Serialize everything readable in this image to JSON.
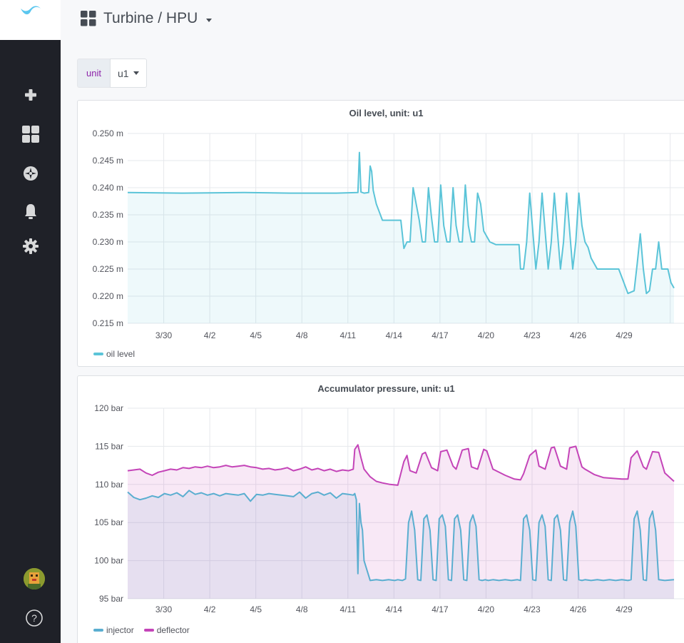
{
  "dashboard": {
    "title": "Turbine / HPU"
  },
  "variable": {
    "label": "unit",
    "value": "u1"
  },
  "colors": {
    "oil": "#5bc4d8",
    "injector": "#5aaed0",
    "deflector": "#c444b8"
  },
  "chart_data": [
    {
      "type": "area",
      "title": "Oil level, unit: u1",
      "y_unit": "m",
      "ylim": [
        0.215,
        0.25
      ],
      "y_ticks": [
        0.215,
        0.22,
        0.225,
        0.23,
        0.235,
        0.24,
        0.245,
        0.25
      ],
      "y_tick_labels": [
        "0.215 m",
        "0.220 m",
        "0.225 m",
        "0.230 m",
        "0.235 m",
        "0.240 m",
        "0.245 m",
        "0.250 m"
      ],
      "x_ticks": [
        3.75,
        6.75,
        9.75,
        12.75,
        15.75,
        18.75,
        21.75,
        24.75,
        27.75,
        30.75,
        33.75,
        36.75
      ],
      "x_tick_labels": [
        "3/30",
        "4/2",
        "4/5",
        "4/8",
        "4/11",
        "4/14",
        "4/17",
        "4/20",
        "4/23",
        "4/26",
        "4/29",
        ""
      ],
      "xlim": [
        1.4,
        37.0
      ],
      "grid": true,
      "legend_placement": "bottom-left",
      "series": [
        {
          "name": "oil level",
          "color": "#5bc4d8",
          "x": [
            1.4,
            5,
            9,
            12,
            15,
            16.4,
            16.5,
            16.6,
            16.7,
            16.8,
            17.1,
            17.2,
            17.3,
            17.4,
            17.6,
            17.8,
            18.0,
            18.3,
            18.8,
            19.2,
            19.4,
            19.6,
            19.8,
            20.0,
            20.2,
            20.4,
            20.6,
            20.8,
            21.0,
            21.2,
            21.4,
            21.6,
            21.8,
            22.0,
            22.2,
            22.4,
            22.6,
            22.8,
            23.0,
            23.2,
            23.4,
            23.6,
            23.8,
            24.0,
            24.2,
            24.4,
            24.6,
            24.8,
            25.0,
            25.4,
            26.0,
            26.6,
            26.9,
            27.0,
            27.2,
            27.4,
            27.6,
            27.8,
            28.0,
            28.2,
            28.4,
            28.6,
            28.8,
            29.0,
            29.2,
            29.4,
            29.6,
            29.8,
            30.0,
            30.2,
            30.4,
            30.6,
            30.8,
            31.0,
            31.2,
            31.4,
            31.6,
            31.8,
            32.0,
            32.2,
            32.6,
            33.0,
            33.4,
            34.0,
            34.4,
            34.6,
            34.8,
            35.0,
            35.2,
            35.4,
            35.6,
            35.8,
            36.0,
            36.2,
            36.4,
            36.6,
            36.8,
            37.0
          ],
          "y": [
            0.2391,
            0.239,
            0.2391,
            0.239,
            0.239,
            0.2391,
            0.2465,
            0.2392,
            0.2391,
            0.239,
            0.2391,
            0.244,
            0.243,
            0.2395,
            0.237,
            0.2355,
            0.234,
            0.234,
            0.234,
            0.234,
            0.2288,
            0.23,
            0.23,
            0.24,
            0.237,
            0.234,
            0.23,
            0.23,
            0.24,
            0.2345,
            0.23,
            0.23,
            0.2405,
            0.233,
            0.23,
            0.23,
            0.24,
            0.233,
            0.23,
            0.23,
            0.2405,
            0.233,
            0.23,
            0.23,
            0.239,
            0.237,
            0.232,
            0.231,
            0.23,
            0.2295,
            0.2295,
            0.2295,
            0.2295,
            0.225,
            0.225,
            0.23,
            0.239,
            0.232,
            0.225,
            0.23,
            0.239,
            0.232,
            0.225,
            0.23,
            0.239,
            0.232,
            0.225,
            0.23,
            0.239,
            0.232,
            0.225,
            0.23,
            0.239,
            0.233,
            0.23,
            0.229,
            0.227,
            0.226,
            0.225,
            0.225,
            0.225,
            0.225,
            0.225,
            0.2205,
            0.221,
            0.226,
            0.2315,
            0.225,
            0.2205,
            0.221,
            0.225,
            0.225,
            0.23,
            0.225,
            0.225,
            0.225,
            0.2225,
            0.2215
          ]
        }
      ]
    },
    {
      "type": "area",
      "title": "Accumulator pressure, unit: u1",
      "y_unit": "bar",
      "ylim": [
        95,
        120
      ],
      "y_ticks": [
        95,
        100,
        105,
        110,
        115,
        120
      ],
      "y_tick_labels": [
        "95 bar",
        "100 bar",
        "105 bar",
        "110 bar",
        "115 bar",
        "120 bar"
      ],
      "x_ticks": [
        3.75,
        6.75,
        9.75,
        12.75,
        15.75,
        18.75,
        21.75,
        24.75,
        27.75,
        30.75,
        33.75
      ],
      "x_tick_labels": [
        "3/30",
        "4/2",
        "4/5",
        "4/8",
        "4/11",
        "4/14",
        "4/17",
        "4/20",
        "4/23",
        "4/26",
        "4/29"
      ],
      "xlim": [
        1.4,
        37.0
      ],
      "grid": true,
      "legend_placement": "bottom-left",
      "series": [
        {
          "name": "injector",
          "color": "#5aaed0",
          "x": [
            1.4,
            1.8,
            2.2,
            2.6,
            3.0,
            3.4,
            3.8,
            4.2,
            4.6,
            5.0,
            5.4,
            5.8,
            6.2,
            6.6,
            7.0,
            7.4,
            7.8,
            8.2,
            8.6,
            9.0,
            9.4,
            9.8,
            10.2,
            10.6,
            11.0,
            11.4,
            11.8,
            12.2,
            12.6,
            13.0,
            13.4,
            13.8,
            14.2,
            14.6,
            15.0,
            15.4,
            15.8,
            16.1,
            16.2,
            16.3,
            16.4,
            16.5,
            16.6,
            16.7,
            16.8,
            17.2,
            17.6,
            18.0,
            18.4,
            18.8,
            19.0,
            19.3,
            19.5,
            19.7,
            19.9,
            20.1,
            20.3,
            20.5,
            20.7,
            20.9,
            21.1,
            21.3,
            21.5,
            21.7,
            21.9,
            22.1,
            22.3,
            22.5,
            22.7,
            22.9,
            23.1,
            23.3,
            23.5,
            23.7,
            23.9,
            24.1,
            24.3,
            24.5,
            24.7,
            24.9,
            25.2,
            25.6,
            26.0,
            26.4,
            26.8,
            27.0,
            27.2,
            27.4,
            27.6,
            27.8,
            28.0,
            28.2,
            28.4,
            28.6,
            28.8,
            29.0,
            29.2,
            29.4,
            29.6,
            29.8,
            30.0,
            30.2,
            30.4,
            30.6,
            30.8,
            31.0,
            31.2,
            31.6,
            32.0,
            32.4,
            32.8,
            33.2,
            33.6,
            34.0,
            34.2,
            34.4,
            34.6,
            34.8,
            35.0,
            35.2,
            35.4,
            35.6,
            35.8,
            36.0,
            36.4,
            37.0
          ],
          "y": [
            109.0,
            108.3,
            108.0,
            108.2,
            108.5,
            108.3,
            108.8,
            108.6,
            108.9,
            108.4,
            109.2,
            108.7,
            108.9,
            108.6,
            108.8,
            108.5,
            108.8,
            108.7,
            108.6,
            108.8,
            107.8,
            108.7,
            108.6,
            108.8,
            108.7,
            108.6,
            108.5,
            108.4,
            109.0,
            108.2,
            108.8,
            109.0,
            108.6,
            108.9,
            108.2,
            108.8,
            108.7,
            108.6,
            108.8,
            108.0,
            98.3,
            107.5,
            105.0,
            104.0,
            100.0,
            97.4,
            97.5,
            97.4,
            97.5,
            97.4,
            97.5,
            97.4,
            97.6,
            105.0,
            106.5,
            104.0,
            97.5,
            97.4,
            105.5,
            106.0,
            104.0,
            97.5,
            97.4,
            105.5,
            106.0,
            104.5,
            97.5,
            97.4,
            105.5,
            106.0,
            104.0,
            97.5,
            97.4,
            105.0,
            106.0,
            104.5,
            97.5,
            97.4,
            97.5,
            97.4,
            97.5,
            97.4,
            97.5,
            97.4,
            97.5,
            97.4,
            105.5,
            106.0,
            104.0,
            97.5,
            97.4,
            105.0,
            106.0,
            104.5,
            97.5,
            97.4,
            105.5,
            106.0,
            104.0,
            97.5,
            97.4,
            105.0,
            106.5,
            104.5,
            97.5,
            97.4,
            97.5,
            97.4,
            97.5,
            97.4,
            97.5,
            97.4,
            97.5,
            97.4,
            97.5,
            105.5,
            106.5,
            104.0,
            97.5,
            97.4,
            105.5,
            106.5,
            104.0,
            97.5,
            97.4,
            97.5
          ]
        },
        {
          "name": "deflector",
          "color": "#c444b8",
          "x": [
            1.4,
            1.8,
            2.2,
            2.6,
            3.0,
            3.4,
            3.8,
            4.2,
            4.6,
            5.0,
            5.4,
            5.8,
            6.2,
            6.6,
            7.0,
            7.4,
            7.8,
            8.2,
            8.6,
            9.0,
            9.4,
            9.8,
            10.2,
            10.6,
            11.0,
            11.4,
            11.8,
            12.2,
            12.6,
            13.0,
            13.4,
            13.8,
            14.2,
            14.6,
            15.0,
            15.4,
            15.8,
            16.1,
            16.2,
            16.4,
            16.6,
            16.8,
            17.2,
            17.6,
            18.0,
            18.5,
            19.0,
            19.4,
            19.6,
            19.8,
            20.2,
            20.6,
            20.8,
            21.2,
            21.6,
            21.8,
            22.2,
            22.6,
            22.8,
            23.2,
            23.6,
            23.8,
            24.2,
            24.6,
            24.8,
            25.2,
            26.0,
            26.6,
            27.0,
            27.2,
            27.6,
            28.0,
            28.2,
            28.6,
            29.0,
            29.2,
            29.6,
            30.0,
            30.2,
            30.6,
            31.0,
            31.2,
            31.8,
            32.4,
            33.0,
            33.6,
            34.0,
            34.2,
            34.6,
            35.0,
            35.2,
            35.6,
            36.0,
            36.4,
            37.0
          ],
          "y": [
            111.8,
            111.9,
            112.0,
            111.5,
            111.2,
            111.6,
            111.8,
            112.0,
            111.9,
            112.2,
            112.1,
            112.3,
            112.2,
            112.4,
            112.2,
            112.3,
            112.5,
            112.3,
            112.4,
            112.5,
            112.3,
            112.2,
            112.0,
            112.1,
            111.9,
            112.0,
            112.2,
            111.8,
            112.0,
            112.3,
            111.9,
            112.1,
            111.8,
            112.0,
            111.7,
            111.9,
            111.8,
            112.0,
            114.6,
            115.2,
            113.5,
            112.0,
            111.0,
            110.4,
            110.2,
            110.0,
            109.9,
            113.0,
            113.8,
            111.8,
            111.5,
            114.0,
            114.2,
            112.2,
            111.8,
            114.3,
            114.5,
            112.4,
            112.0,
            114.5,
            114.7,
            112.3,
            112.0,
            114.6,
            114.4,
            112.0,
            111.2,
            110.7,
            110.6,
            111.4,
            113.8,
            114.5,
            112.4,
            112.0,
            114.8,
            114.9,
            112.4,
            112.0,
            114.8,
            115.0,
            112.3,
            112.0,
            111.3,
            110.9,
            110.8,
            110.7,
            110.7,
            113.5,
            114.4,
            112.3,
            112.0,
            114.3,
            114.2,
            111.5,
            110.4
          ]
        }
      ]
    }
  ]
}
